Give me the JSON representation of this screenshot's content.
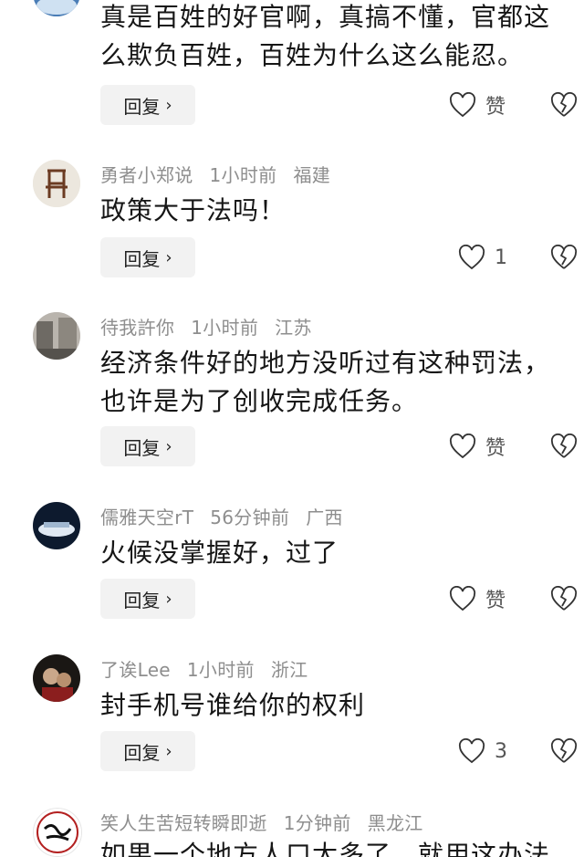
{
  "comments": [
    {
      "username": "",
      "time": "",
      "location": "",
      "text": "真是百姓的好官啊，真搞不懂，官都这\n么欺负百姓，百姓为什么这么能忍。",
      "reply_label": "回复",
      "like_label": "赞",
      "avatar_icon": "avatar-icon"
    },
    {
      "username": "勇者小郑说",
      "time": "1小时前",
      "location": "福建",
      "text": "政策大于法吗！",
      "reply_label": "回复",
      "like_label": "1",
      "avatar_icon": "avatar-chair-icon"
    },
    {
      "username": "待我許你",
      "time": "1小时前",
      "location": "江苏",
      "text": "经济条件好的地方没听过有这种罚法，\n也许是为了创收完成任务。",
      "reply_label": "回复",
      "like_label": "赞",
      "avatar_icon": "avatar-street-icon"
    },
    {
      "username": "儒雅天空rT",
      "time": "56分钟前",
      "location": "广西",
      "text": "火候没掌握好，过了",
      "reply_label": "回复",
      "like_label": "赞",
      "avatar_icon": "avatar-car-icon"
    },
    {
      "username": "了诶Lee",
      "time": "1小时前",
      "location": "浙江",
      "text": "封手机号谁给你的权利",
      "reply_label": "回复",
      "like_label": "3",
      "avatar_icon": "avatar-people-icon"
    },
    {
      "username": "笑人生苦短转瞬即逝",
      "time": "1分钟前",
      "location": "黑龙江",
      "text": "如果一个地方人口太多了，就用这办法",
      "reply_label": "",
      "like_label": "",
      "avatar_icon": "avatar-calligraphy-icon"
    }
  ],
  "icons": {
    "reply_chevron": "chevron-right-icon",
    "like": "heart-icon",
    "dislike": "broken-heart-icon"
  },
  "colors": {
    "meta_text": "#8e8e8e",
    "reply_bg": "#f2f2f2"
  }
}
